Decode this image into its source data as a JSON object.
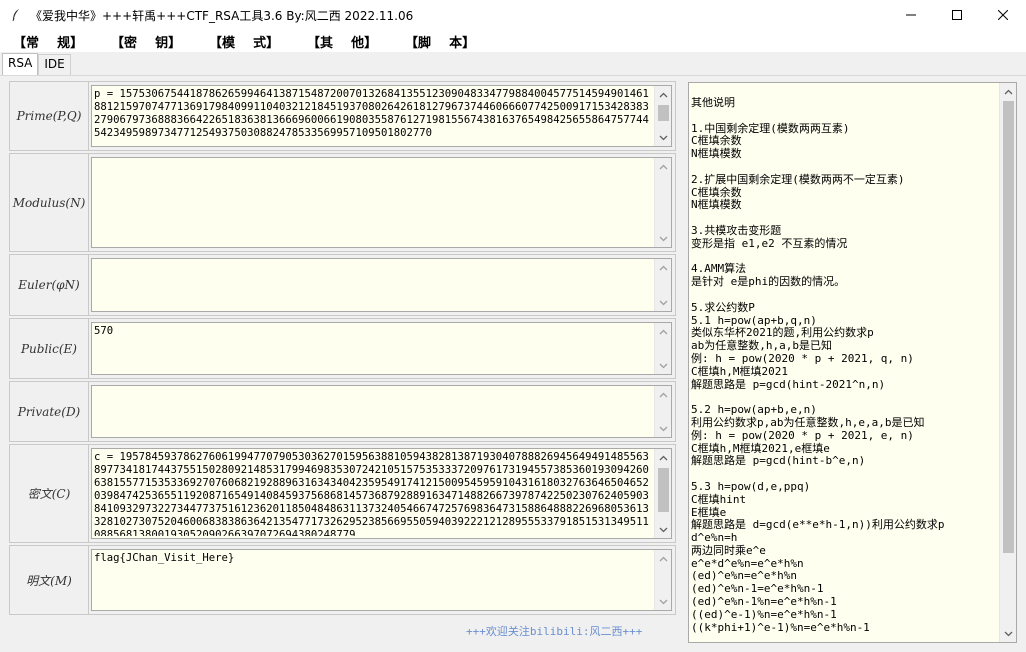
{
  "window": {
    "title": "《爱我中华》+++轩禹+++CTF_RSA工具3.6   By:风二西 2022.11.06"
  },
  "menu": {
    "items": [
      {
        "label": "【常    规】"
      },
      {
        "label": "【密    钥】"
      },
      {
        "label": "【模    式】"
      },
      {
        "label": "【其    他】"
      },
      {
        "label": "【脚    本】"
      }
    ]
  },
  "tabs": [
    {
      "label": "RSA",
      "active": true
    },
    {
      "label": "IDE",
      "active": false
    }
  ],
  "fields": {
    "prime": {
      "label": "Prime(P,Q)",
      "value": "p = 1575306754418786265994641387154872007013268413551230904833477988400457751459490146188121597074771369179840991104032121845193708026426181279673744606660774250091715342838327906797368883664226518363813666960066190803558761271981556743816376549842565586475774454234959897347712549375030882478533569957109501802770"
    },
    "modulus": {
      "label": "Modulus(N)",
      "value": ""
    },
    "euler": {
      "label": "Euler(φN)",
      "value": ""
    },
    "public": {
      "label": "Public(E)",
      "value": "570"
    },
    "private": {
      "label": "Private(D)",
      "value": ""
    },
    "cipher": {
      "label": "密文(C)",
      "value": "c = 1957845937862760619947707905303627015956388105943828138719304078882694564949148556389773418174437551502809214853179946983530724210515753533372097617319455738536019309426063815577153533692707606821928896316343404235954917412150095459591043161803276364650465203984742536551192087165491408459375686814573687928891634714882667397874225023076240590384109329732273447737516123620118504848631137324054667472576983647315886488822696805361332810273075204600683838636421354771732629523856695505940392221212895553379185153134951108856813800193052090266397072694380248779"
    },
    "plain": {
      "label": "明文(M)",
      "value": "flag{JChan_Visit_Here}"
    }
  },
  "notes": {
    "text": "其他说明\n\n1.中国剩余定理(模数两两互素)\nC框填余数\nN框填模数\n\n2.扩展中国剩余定理(模数两两不一定互素)\nC框填余数\nN框填模数\n\n3.共模攻击变形题\n变形是指 e1,e2 不互素的情况\n\n4.AMM算法\n是针对 e是phi的因数的情况。\n\n5.求公约数P\n5.1 h=pow(ap+b,q,n)\n类似东华杯2021的题,利用公约数求p\nab为任意整数,h,a,b是已知\n例: h = pow(2020 * p + 2021, q, n)\nC框填h,M框填2021\n解题思路是 p=gcd(hint-2021^n,n)\n\n5.2 h=pow(ap+b,e,n)\n利用公约数求p,ab为任意整数,h,e,a,b是已知\n例: h = pow(2020 * p + 2021, e, n)\nC框填h,M框填2021,e框填e\n解题思路是 p=gcd(hint-b^e,n)\n\n5.3 h=pow(d,e,ppq)\nC框填hint\nE框填e\n解题思路是 d=gcd(e**e*h-1,n))利用公约数求p\nd^e%n=h\n两边同时乘e^e\ne^e*d^e%n=e^e*h%n\n(ed)^e%n=e^e*h%n\n(ed)^e%n-1=e^e*h%n-1\n(ed)^e%n-1%n=e^e*h%n-1\n((ed)^e-1)%n=e^e*h%n-1\n((k*phi+1)^e-1)%n=e^e*h%n-1"
  },
  "footer": {
    "text": "+++欢迎关注bilibili:风二西+++"
  }
}
